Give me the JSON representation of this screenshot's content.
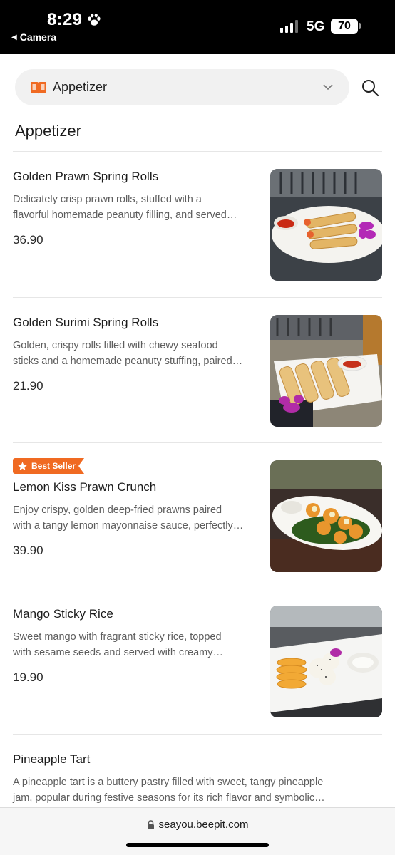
{
  "status_bar": {
    "time": "8:29",
    "back_label": "Camera",
    "network": "5G",
    "battery": "70",
    "icons": [
      "paw-icon",
      "signal-icon",
      "battery-icon"
    ]
  },
  "category_select": {
    "selected": "Appetizer",
    "icon": "menu-book-icon",
    "chevron": "chevron-down-icon"
  },
  "search": {
    "icon": "search-icon"
  },
  "section": {
    "title": "Appetizer"
  },
  "items": [
    {
      "name": "Golden Prawn Spring Rolls",
      "description_line1": "Delicately crisp prawn rolls, stuffed with a",
      "description_line2": "flavorful homemade peanuty filling, and served…",
      "price": "36.90"
    },
    {
      "name": "Golden Surimi Spring Rolls",
      "description_line1": "Golden, crispy rolls filled with chewy seafood",
      "description_line2": "sticks and a homemade peanuty stuffing, paired…",
      "price": "21.90"
    },
    {
      "badge": "Best Seller",
      "name": "Lemon Kiss Prawn Crunch",
      "description_line1": "Enjoy crispy, golden deep-fried prawns paired",
      "description_line2": "with a tangy lemon mayonnaise sauce, perfectly…",
      "price": "39.90"
    },
    {
      "name": "Mango Sticky Rice",
      "description_line1": "Sweet mango with fragrant sticky rice, topped",
      "description_line2": "with sesame seeds and served with creamy…",
      "price": "19.90"
    },
    {
      "name": "Pineapple Tart",
      "description_line1": "A pineapple tart is a buttery pastry filled with sweet, tangy pineapple",
      "description_line2": "jam, popular during festive seasons for its rich flavor and symbolic…"
    }
  ],
  "browser": {
    "url": "seayou.beepit.com",
    "icon": "lock-icon"
  },
  "colors": {
    "accent": "#f06a22",
    "badge_text": "#ffffff"
  }
}
